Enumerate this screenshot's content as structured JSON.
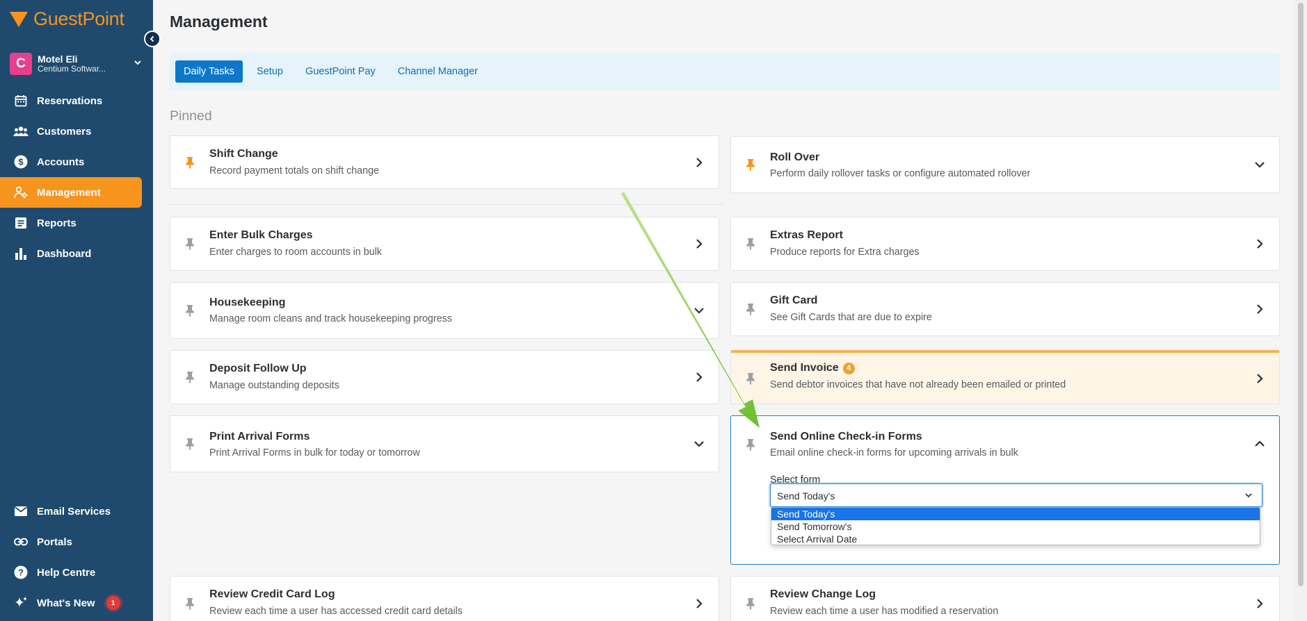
{
  "brand": {
    "name": "GuestPoint",
    "color": "#f7941d"
  },
  "property": {
    "initial": "C",
    "name": "Motel Eli",
    "company": "Centium Softwar..."
  },
  "sidebar": {
    "items": [
      {
        "label": "Reservations",
        "icon": "calendar-icon"
      },
      {
        "label": "Customers",
        "icon": "users-icon"
      },
      {
        "label": "Accounts",
        "icon": "dollar-icon"
      },
      {
        "label": "Management",
        "icon": "management-icon",
        "active": true
      },
      {
        "label": "Reports",
        "icon": "report-icon"
      },
      {
        "label": "Dashboard",
        "icon": "bar-chart-icon"
      }
    ],
    "bottom_items": [
      {
        "label": "Email Services",
        "icon": "mail-icon"
      },
      {
        "label": "Portals",
        "icon": "link-icon"
      },
      {
        "label": "Help Centre",
        "icon": "help-icon"
      },
      {
        "label": "What's New",
        "icon": "sparkle-icon",
        "badge": "1"
      }
    ]
  },
  "page": {
    "title": "Management",
    "section": "Pinned"
  },
  "tabs": [
    "Daily Tasks",
    "Setup",
    "GuestPoint Pay",
    "Channel Manager"
  ],
  "tasks": {
    "shift_change": {
      "title": "Shift Change",
      "desc": "Record payment totals on shift change"
    },
    "roll_over": {
      "title": "Roll Over",
      "desc": "Perform daily rollover tasks or configure automated rollover"
    },
    "bulk_charges": {
      "title": "Enter Bulk Charges",
      "desc": "Enter charges to room accounts in bulk"
    },
    "extras_report": {
      "title": "Extras Report",
      "desc": "Produce reports for Extra charges"
    },
    "housekeeping": {
      "title": "Housekeeping",
      "desc": "Manage room cleans and track housekeeping progress"
    },
    "gift_card": {
      "title": "Gift Card",
      "desc": "See Gift Cards that are due to expire"
    },
    "deposit": {
      "title": "Deposit Follow Up",
      "desc": "Manage outstanding deposits"
    },
    "send_invoice": {
      "title": "Send Invoice",
      "badge": "4",
      "desc": "Send debtor invoices that have not already been emailed or printed"
    },
    "arrival_forms": {
      "title": "Print Arrival Forms",
      "desc": "Print Arrival Forms in bulk for today or tomorrow"
    },
    "checkin_forms": {
      "title": "Send Online Check-in Forms",
      "desc": "Email online check-in forms for upcoming arrivals in bulk",
      "select_label": "Select form",
      "selected": "Send Today's",
      "options": [
        "Send Today's",
        "Send Tomorrow's",
        "Select Arrival Date"
      ]
    },
    "credit_card_log": {
      "title": "Review Credit Card Log",
      "desc": "Review each time a user has accessed credit card details"
    },
    "change_log": {
      "title": "Review Change Log",
      "desc": "Review each time a user has modified a reservation"
    }
  },
  "colors": {
    "sidebar": "#1f4a6e",
    "accent": "#f7941d",
    "tab_active": "#0d78c9",
    "annotation_arrow": "#7cc43a"
  }
}
